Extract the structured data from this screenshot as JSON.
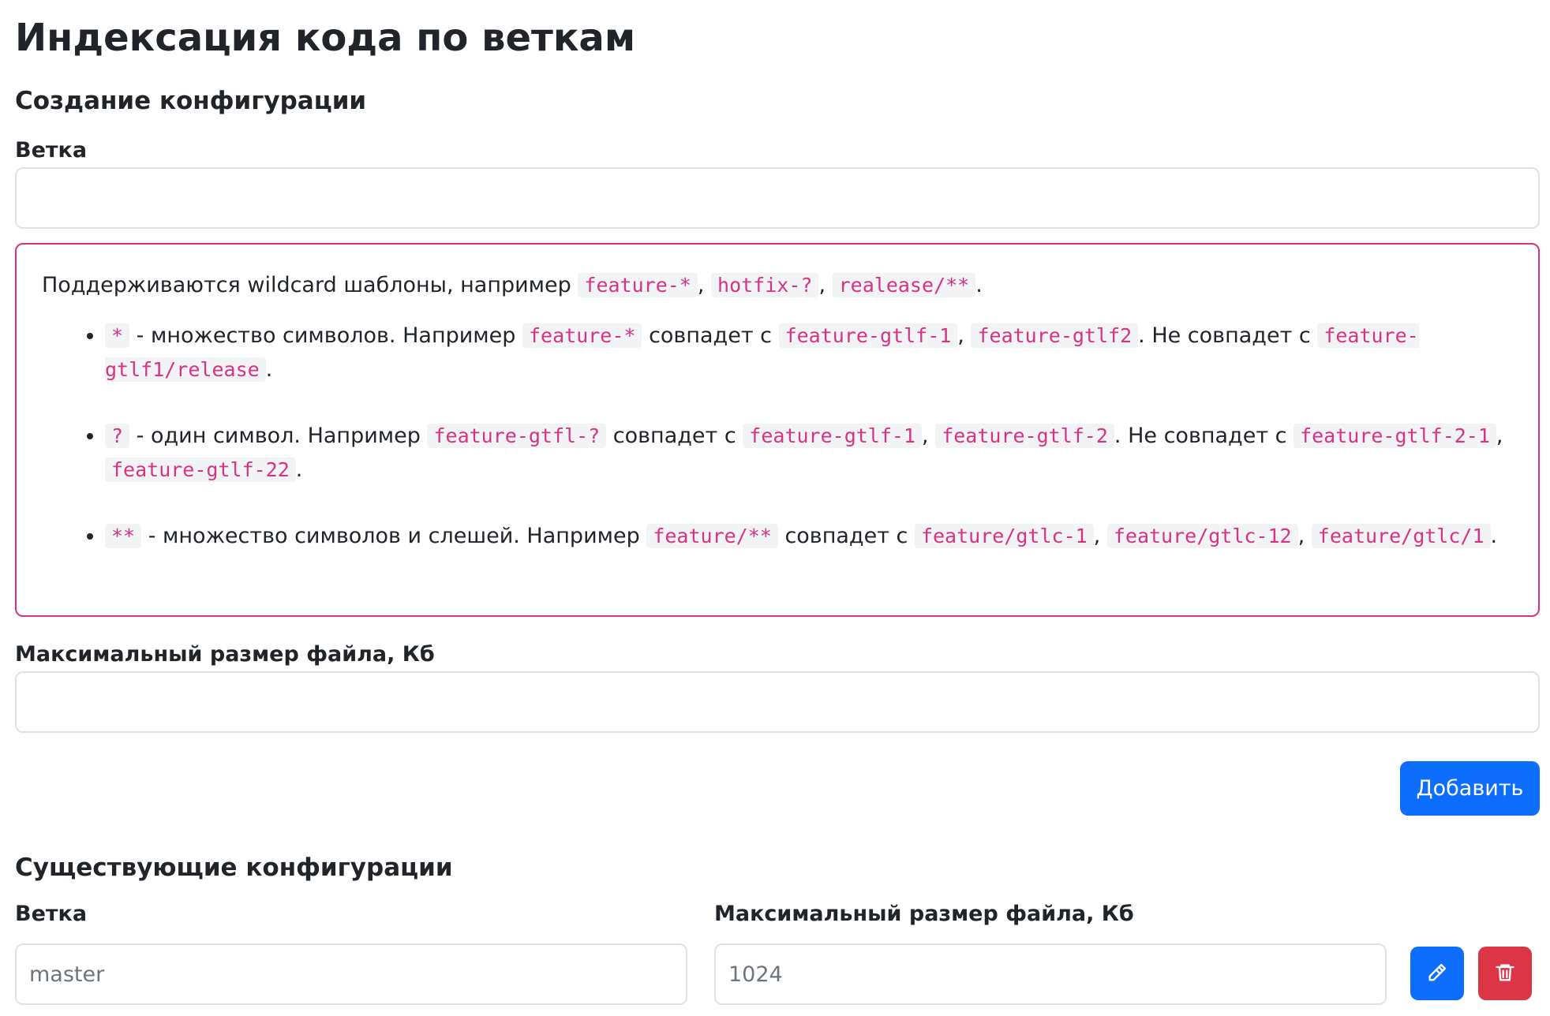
{
  "page": {
    "title": "Индексация кода по веткам"
  },
  "create": {
    "heading": "Создание конфигурации",
    "branch_label": "Ветка",
    "branch_value": "",
    "max_size_label": "Максимальный размер файла, Кб",
    "max_size_value": "",
    "add_button": "Добавить"
  },
  "hint": {
    "intro": "Поддерживаются wildcard шаблоны, например",
    "intro_examples": [
      "feature-*",
      "hotfix-?",
      "realease/**"
    ],
    "items": [
      {
        "pattern": "*",
        "description": "- множество символов. Например",
        "example": "feature-*",
        "matches_text": "совпадет с",
        "matches": [
          "feature-gtlf-1",
          "feature-gtlf2"
        ],
        "nonmatch_text": "Не совпадет с",
        "nonmatches": [
          "feature-gtlf1/release"
        ]
      },
      {
        "pattern": "?",
        "description": "- один символ. Например",
        "example": "feature-gtfl-?",
        "matches_text": "совпадет с",
        "matches": [
          "feature-gtlf-1",
          "feature-gtlf-2"
        ],
        "nonmatch_text": "Не совпадет с",
        "nonmatches": [
          "feature-gtlf-2-1",
          "feature-gtlf-22"
        ]
      },
      {
        "pattern": "**",
        "description": "- множество символов и слешей. Например",
        "example": "feature/**",
        "matches_text": "совпадет с",
        "matches": [
          "feature/gtlc-1",
          "feature/gtlc-12",
          "feature/gtlc/1"
        ],
        "nonmatch_text": "",
        "nonmatches": []
      }
    ]
  },
  "existing": {
    "heading": "Существующие конфигурации",
    "branch_label": "Ветка",
    "max_size_label": "Максимальный размер файла, Кб",
    "rows": [
      {
        "branch": "master",
        "max_size": "1024",
        "edit_icon": "pencil-icon",
        "delete_icon": "trash-icon"
      }
    ]
  },
  "colors": {
    "primary": "#0d6efd",
    "danger": "#dc3545",
    "code": "#d63384",
    "hint_border": "#d63384"
  }
}
